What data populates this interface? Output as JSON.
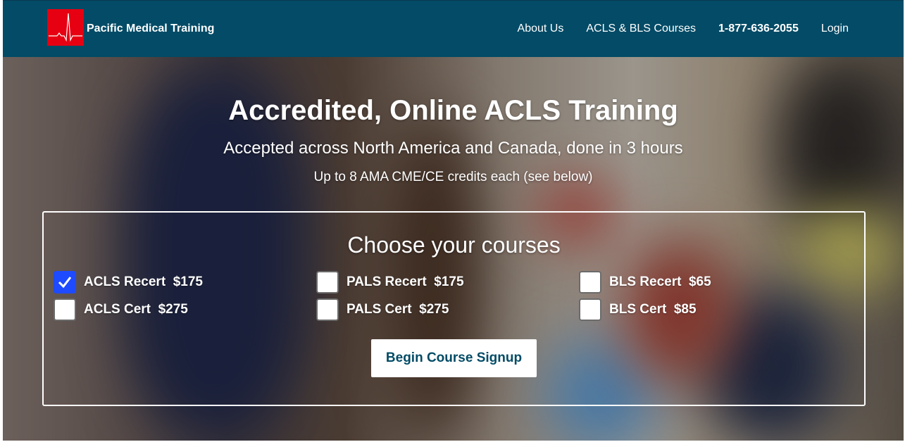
{
  "nav": {
    "brand": "Pacific Medical Training",
    "links": [
      {
        "label": "About Us"
      },
      {
        "label": "ACLS & BLS Courses"
      },
      {
        "label": "1-877-636-2055"
      },
      {
        "label": "Login"
      }
    ]
  },
  "hero": {
    "title": "Accredited, Online ACLS Training",
    "subtitle": "Accepted across North America and Canada, done in 3 hours",
    "credits": "Up to 8 AMA CME/CE credits each (see below)"
  },
  "courses": {
    "heading": "Choose your courses",
    "options": [
      {
        "name": "ACLS Recert",
        "price": "$175",
        "checked": true
      },
      {
        "name": "ACLS Cert",
        "price": "$275",
        "checked": false
      },
      {
        "name": "PALS Recert",
        "price": "$175",
        "checked": false
      },
      {
        "name": "PALS Cert",
        "price": "$275",
        "checked": false
      },
      {
        "name": "BLS Recert",
        "price": "$65",
        "checked": false
      },
      {
        "name": "BLS Cert",
        "price": "$85",
        "checked": false
      }
    ],
    "button_label": "Begin Course Signup"
  },
  "colors": {
    "navbar": "#034b66",
    "logo_bg": "#e60012",
    "checkbox_checked": "#1e4bff",
    "button_text": "#034b66"
  },
  "icons": {
    "logo": "ecg-heartbeat-icon",
    "checked": "checkmark-icon"
  }
}
